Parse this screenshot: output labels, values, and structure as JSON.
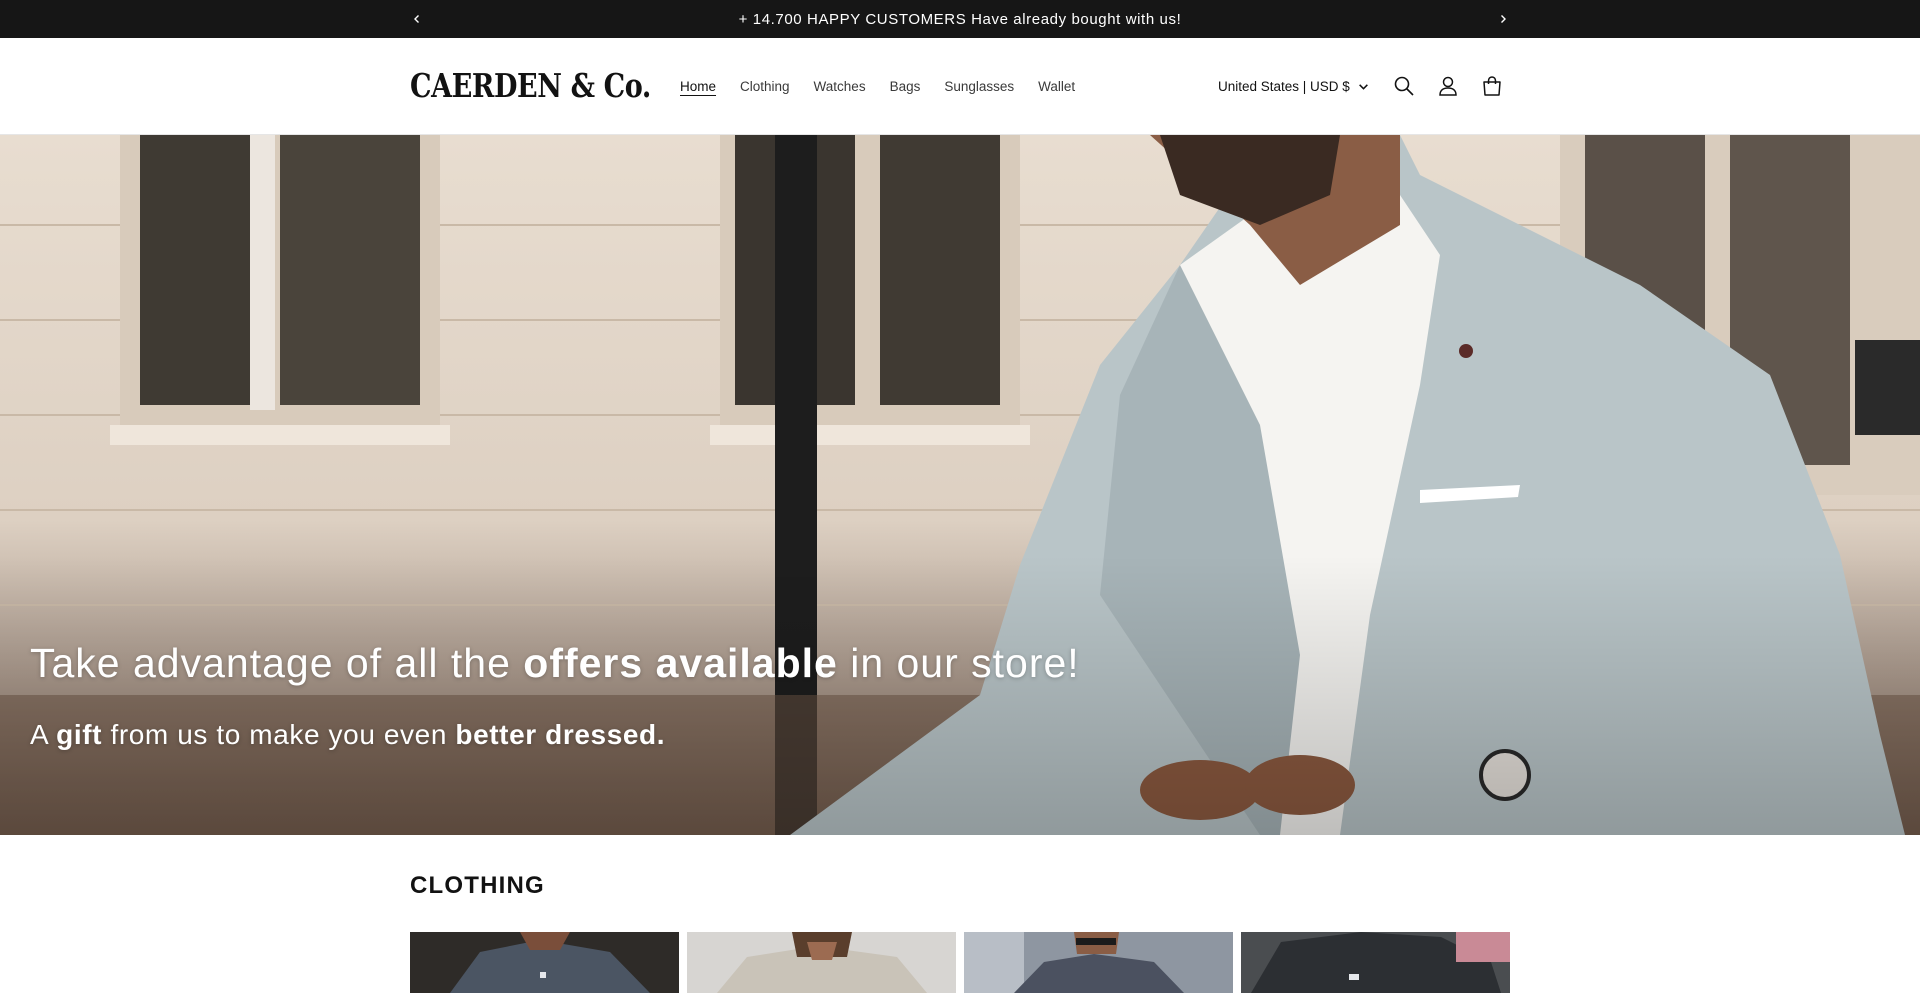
{
  "announcement": {
    "message": "+ 14.700 HAPPY CUSTOMERS Have already bought with us!",
    "prev_icon": "chevron-left-icon",
    "next_icon": "chevron-right-icon"
  },
  "header": {
    "logo": "CAERDEN & Co.",
    "nav": [
      {
        "label": "Home",
        "active": true
      },
      {
        "label": "Clothing"
      },
      {
        "label": "Watches"
      },
      {
        "label": "Bags"
      },
      {
        "label": "Sunglasses"
      },
      {
        "label": "Wallet"
      }
    ],
    "locale": "United States | USD $",
    "icons": [
      "search-icon",
      "account-icon",
      "cart-icon"
    ]
  },
  "hero": {
    "headline": {
      "part1": "Take advantage of all the ",
      "bold": "offers available",
      "part2": " in our store!"
    },
    "subline": {
      "part1": "A ",
      "bold1": "gift",
      "part2": " from us to make you even ",
      "bold2": "better dressed."
    }
  },
  "collection": {
    "title": "CLOTHING",
    "cards": [
      "product-card-1",
      "product-card-2",
      "product-card-3",
      "product-card-4"
    ]
  },
  "colors": {
    "announcement_bg": "#161616",
    "text": "#121212",
    "hero_text": "#ffffff"
  }
}
